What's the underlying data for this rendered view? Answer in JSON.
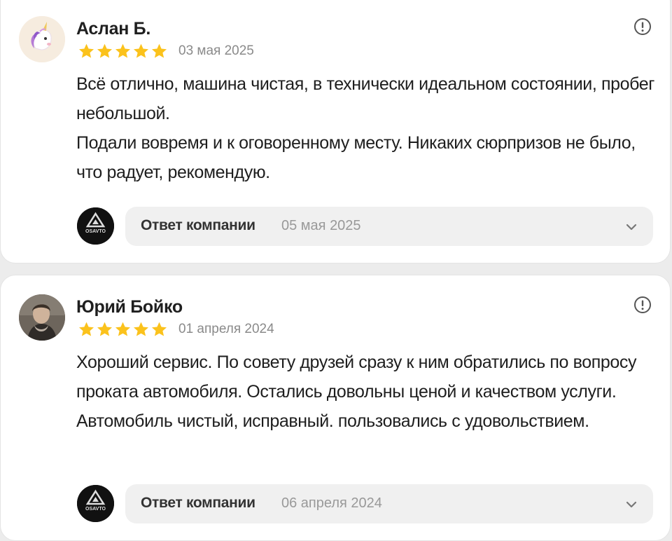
{
  "reviews": [
    {
      "author": "Аслан Б.",
      "rating": 5,
      "date": "03 мая 2025",
      "text_lines": [
        "Всё отлично, машина чистая, в технически идеальном состоянии, пробег небольшой.",
        "Подали вовремя и к оговоренному месту. Никаких сюрпризов не было, что радует, рекомендую."
      ],
      "reply": {
        "label": "Ответ компании",
        "date": "05 мая 2025"
      }
    },
    {
      "author": "Юрий Бойко",
      "rating": 5,
      "date": "01 апреля 2024",
      "text_lines": [
        "Хороший сервис. По совету друзей сразу к ним обратились по вопросу проката автомобиля. Остались довольны ценой и качеством услуги. Автомобиль чистый, исправный. пользовались с удовольствием."
      ],
      "reply": {
        "label": "Ответ компании",
        "date": "06 апреля 2024"
      }
    }
  ],
  "company_logo_text": "OSAVTO",
  "icons": {
    "star": "star-icon",
    "complain": "exclamation-circle-icon",
    "expand": "chevron-down-icon"
  },
  "colors": {
    "star": "#fbc21c",
    "reply_background": "#f0f0f0",
    "muted_text": "#8a8a8a"
  }
}
